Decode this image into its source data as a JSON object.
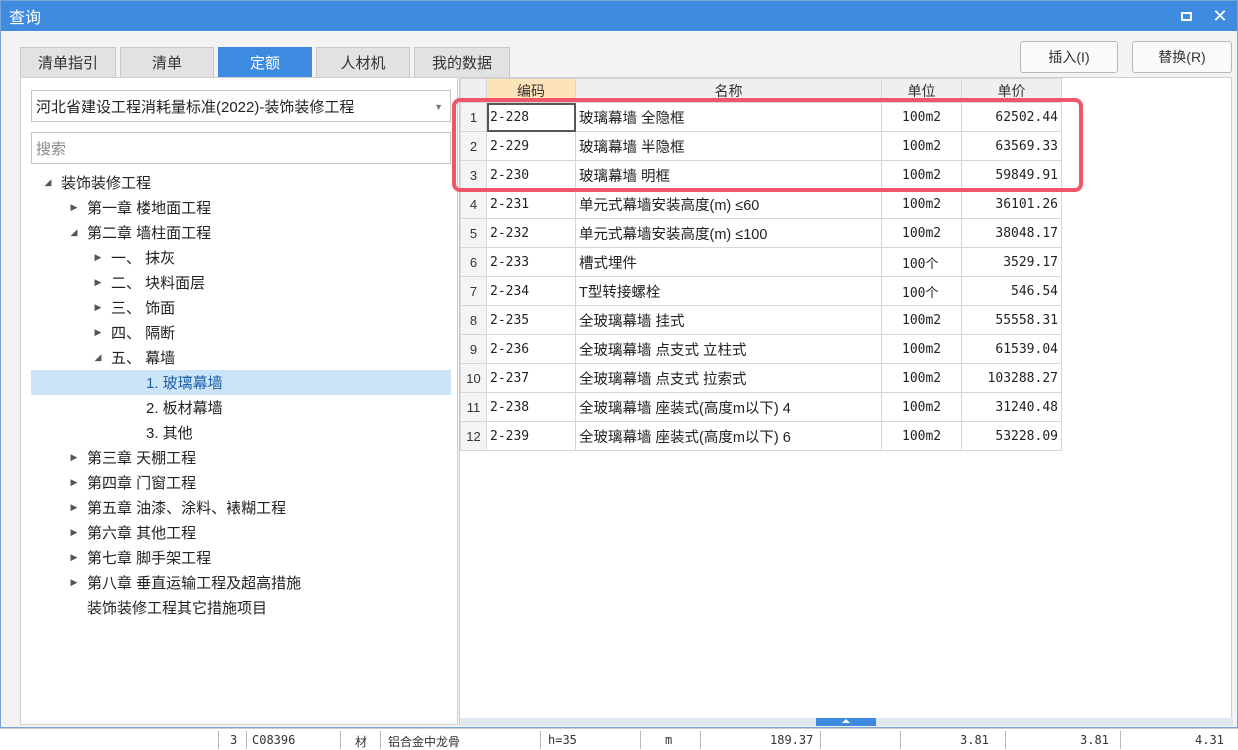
{
  "dialog": {
    "title": "查询"
  },
  "tabs": [
    {
      "label": "清单指引",
      "active": false
    },
    {
      "label": "清单",
      "active": false
    },
    {
      "label": "定额",
      "active": true
    },
    {
      "label": "人材机",
      "active": false
    },
    {
      "label": "我的数据",
      "active": false
    }
  ],
  "buttons": {
    "insert": "插入(I)",
    "replace": "替换(R)"
  },
  "library": {
    "selected": "河北省建设工程消耗量标准(2022)-装饰装修工程"
  },
  "search": {
    "placeholder": "搜索"
  },
  "tree": [
    {
      "label": "装饰装修工程",
      "level": 0,
      "caret": "down"
    },
    {
      "label": "第一章 楼地面工程",
      "level": 1,
      "caret": "right"
    },
    {
      "label": "第二章 墙柱面工程",
      "level": 1,
      "caret": "down"
    },
    {
      "label": "一、 抹灰",
      "level": 2,
      "caret": "right"
    },
    {
      "label": "二、 块料面层",
      "level": 2,
      "caret": "right"
    },
    {
      "label": "三、 饰面",
      "level": 2,
      "caret": "right"
    },
    {
      "label": "四、 隔断",
      "level": 2,
      "caret": "right"
    },
    {
      "label": "五、 幕墙",
      "level": 2,
      "caret": "down"
    },
    {
      "label": "1. 玻璃幕墙",
      "level": 3,
      "caret": "none",
      "selected": true
    },
    {
      "label": "2. 板材幕墙",
      "level": 3,
      "caret": "none"
    },
    {
      "label": "3. 其他",
      "level": 3,
      "caret": "none"
    },
    {
      "label": "第三章 天棚工程",
      "level": 1,
      "caret": "right"
    },
    {
      "label": "第四章 门窗工程",
      "level": 1,
      "caret": "right"
    },
    {
      "label": "第五章 油漆、涂料、裱糊工程",
      "level": 1,
      "caret": "right"
    },
    {
      "label": "第六章 其他工程",
      "level": 1,
      "caret": "right"
    },
    {
      "label": "第七章 脚手架工程",
      "level": 1,
      "caret": "right"
    },
    {
      "label": "第八章 垂直运输工程及超高措施",
      "level": 1,
      "caret": "right"
    },
    {
      "label": "装饰装修工程其它措施项目",
      "level": 1,
      "caret": "none"
    }
  ],
  "table": {
    "headers": [
      "",
      "编码",
      "名称",
      "单位",
      "单价"
    ],
    "rows": [
      {
        "idx": "1",
        "code": "2-228",
        "name": "玻璃幕墙 全隐框",
        "unit": "100m2",
        "price": "62502.44"
      },
      {
        "idx": "2",
        "code": "2-229",
        "name": "玻璃幕墙 半隐框",
        "unit": "100m2",
        "price": "63569.33"
      },
      {
        "idx": "3",
        "code": "2-230",
        "name": "玻璃幕墙 明框",
        "unit": "100m2",
        "price": "59849.91"
      },
      {
        "idx": "4",
        "code": "2-231",
        "name": "单元式幕墙安装高度(m) ≤60",
        "unit": "100m2",
        "price": "36101.26"
      },
      {
        "idx": "5",
        "code": "2-232",
        "name": "单元式幕墙安装高度(m) ≤100",
        "unit": "100m2",
        "price": "38048.17"
      },
      {
        "idx": "6",
        "code": "2-233",
        "name": "槽式埋件",
        "unit": "100个",
        "price": "3529.17"
      },
      {
        "idx": "7",
        "code": "2-234",
        "name": "T型转接螺栓",
        "unit": "100个",
        "price": "546.54"
      },
      {
        "idx": "8",
        "code": "2-235",
        "name": "全玻璃幕墙 挂式",
        "unit": "100m2",
        "price": "55558.31"
      },
      {
        "idx": "9",
        "code": "2-236",
        "name": "全玻璃幕墙 点支式 立柱式",
        "unit": "100m2",
        "price": "61539.04"
      },
      {
        "idx": "10",
        "code": "2-237",
        "name": "全玻璃幕墙 点支式 拉索式",
        "unit": "100m2",
        "price": "103288.27"
      },
      {
        "idx": "11",
        "code": "2-238",
        "name": "全玻璃幕墙 座装式(高度m以下) 4",
        "unit": "100m2",
        "price": "31240.48"
      },
      {
        "idx": "12",
        "code": "2-239",
        "name": "全玻璃幕墙 座装式(高度m以下) 6",
        "unit": "100m2",
        "price": "53228.09"
      }
    ]
  },
  "background_row": {
    "no": "3",
    "code": "C08396",
    "type": "材",
    "name": "铝合金中龙骨",
    "spec": "h=35",
    "unit": "m",
    "qty": "189.37",
    "price1": "3.81",
    "price2": "3.81",
    "price3": "4.31"
  },
  "colors": {
    "accent": "#3d8ae0",
    "highlight": "#f0566b",
    "selected_row": "#cce4f7"
  }
}
